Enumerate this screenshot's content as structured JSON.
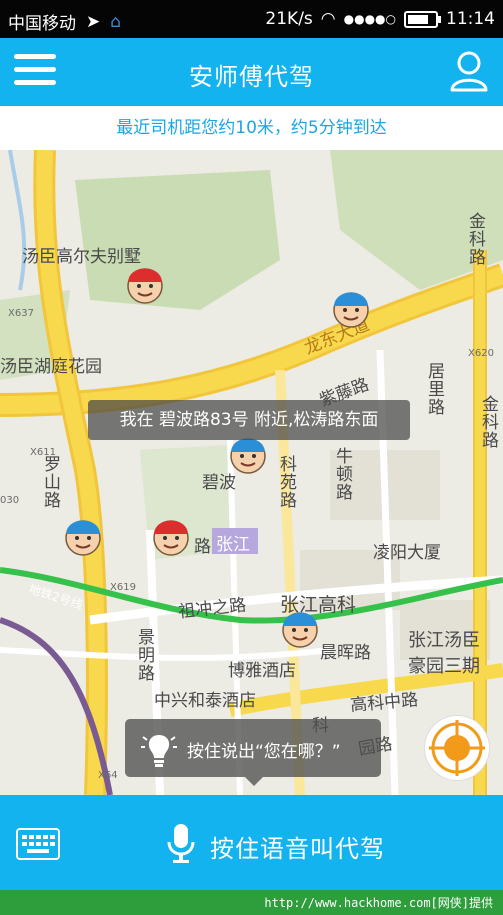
{
  "status_bar": {
    "carrier": "中国移动",
    "speed": "21K/s",
    "signal_dots": "●●●●○",
    "time": "11:14",
    "battery_level": 0.75
  },
  "header": {
    "title": "安师傅代驾",
    "menu_icon": "menu-icon",
    "user_icon": "user-icon"
  },
  "notice": "最近司机距您约10米，约5分钟到达",
  "map": {
    "places": {
      "golf": "汤臣高尔夫别墅",
      "lake": "汤臣湖庭花园",
      "longdong": "龙东大道",
      "luoshan": "罗山路",
      "jingxiu": "居里路",
      "jinke_top": "金科路",
      "jinke_mid": "金科路",
      "ziteng": "紫藤路",
      "zhenyuan": "科苑路",
      "niudun": "牛顿路",
      "bibo": "碧波",
      "lingyang": "凌阳大厦",
      "zhangjiang": "张江",
      "zhangjiang_gaoke": "张江高科",
      "zuchongzhi": "祖冲之路",
      "jingming": "景明路",
      "boya": "博雅酒店",
      "chenhui": "晨晖路",
      "zhongxing": "中兴和泰酒店",
      "gaoke_mid": "高科中路",
      "tangchen_haoyuan": "张江汤臣豪园三期",
      "metro": "地铁2号线",
      "lu_suffix": "路",
      "ke": "科",
      "yuan": "园路",
      "x637": "X637",
      "x620": "X620",
      "x611": "X611",
      "x619": "X619",
      "x64": "X64",
      "n030": "030"
    },
    "location_bubble": "我在 碧波路83号 附近,松涛路东面",
    "voice_hint": "按住说出“您在哪？”",
    "locate_icon": "locate-icon"
  },
  "bottom_bar": {
    "keyboard_icon": "keyboard-icon",
    "mic_icon": "mic-icon",
    "call_label": "按住语音叫代驾"
  },
  "watermark": "http://www.hackhome.com[网侠]提供",
  "colors": {
    "accent": "#12b3ee",
    "notice_text": "#1aa6e4",
    "metro_line": "#35c14a",
    "main_road": "#f8d84c"
  }
}
